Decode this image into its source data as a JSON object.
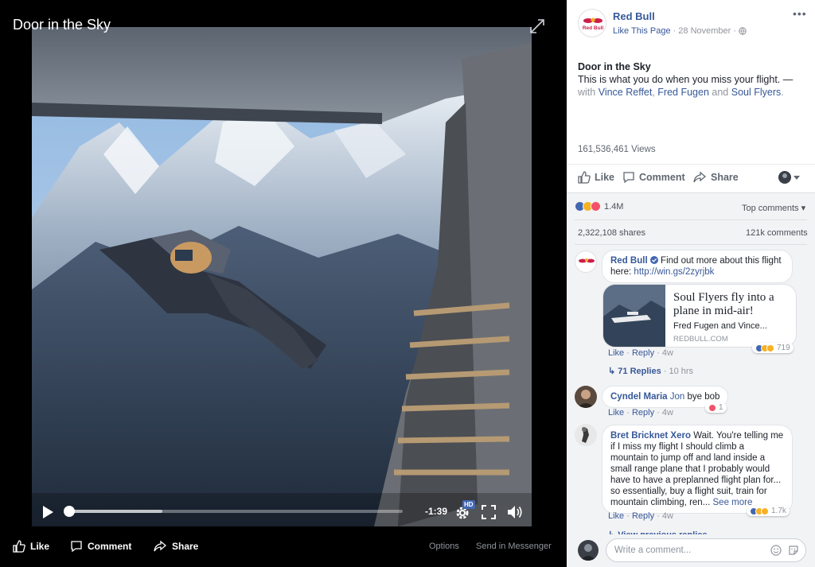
{
  "video": {
    "title": "Door in the Sky",
    "time_remaining": "-1:39",
    "progress_fraction": 0.0,
    "buffered_fraction": 0.28,
    "hd_label": "HD",
    "actions": {
      "like": "Like",
      "comment": "Comment",
      "share": "Share"
    },
    "options_label": "Options",
    "messenger_label": "Send in Messenger"
  },
  "post": {
    "page_name": "Red Bull",
    "avatar_text": "Red Bull",
    "like_page": "Like This Page",
    "date": "· 28 November ·",
    "title": "Door in the Sky",
    "text": "This is what you do when you miss your flight. —",
    "tags": {
      "with": "with ",
      "person1": "Vince Reffet",
      "comma": ", ",
      "person2": "Fred Fugen",
      "and": " and ",
      "person3": "Soul Flyers",
      "end": "."
    },
    "views": "161,536,461 Views",
    "actions": {
      "like": "Like",
      "comment": "Comment",
      "share": "Share"
    }
  },
  "engagement": {
    "reactions": "1.4M",
    "top_comments": "Top comments ▾",
    "shares": "2,322,108 shares",
    "comments": "121k comments"
  },
  "comments": [
    {
      "author": "Red Bull",
      "text": "Find out more about this flight here: ",
      "link": "http://win.gs/2zyrjbk",
      "link_card": {
        "headline": "Soul Flyers fly into a plane in mid-air!",
        "description": "Fred Fugen and Vince...",
        "domain": "REDBULL.COM"
      },
      "like": "Like",
      "reply": "Reply",
      "time": "4w",
      "reactions": "719",
      "replies": "71 Replies",
      "replies_time": "· 10 hrs"
    },
    {
      "author": "Cyndel Maria",
      "tag": "Jon",
      "text": " bye bob",
      "like": "Like",
      "reply": "Reply",
      "time": "4w",
      "reactions": "1"
    },
    {
      "author": "Bret Bricknet Xero",
      "text": "Wait. You're telling me if I miss my flight I should climb a mountain to jump off and land inside a small range plane that I probably would have to have a preplanned flight plan for... so essentially, buy a flight suit, train for mountain climbing, ren...",
      "see_more": "See more",
      "like": "Like",
      "reply": "Reply",
      "time": "4w",
      "reactions": "1.7k"
    }
  ],
  "view_previous": "View previous replies",
  "composer": {
    "placeholder": "Write a comment..."
  },
  "colors": {
    "link_blue": "#365899",
    "like_blue": "#4267b2",
    "love_red": "#f25268",
    "haha_yellow": "#f7b125"
  }
}
